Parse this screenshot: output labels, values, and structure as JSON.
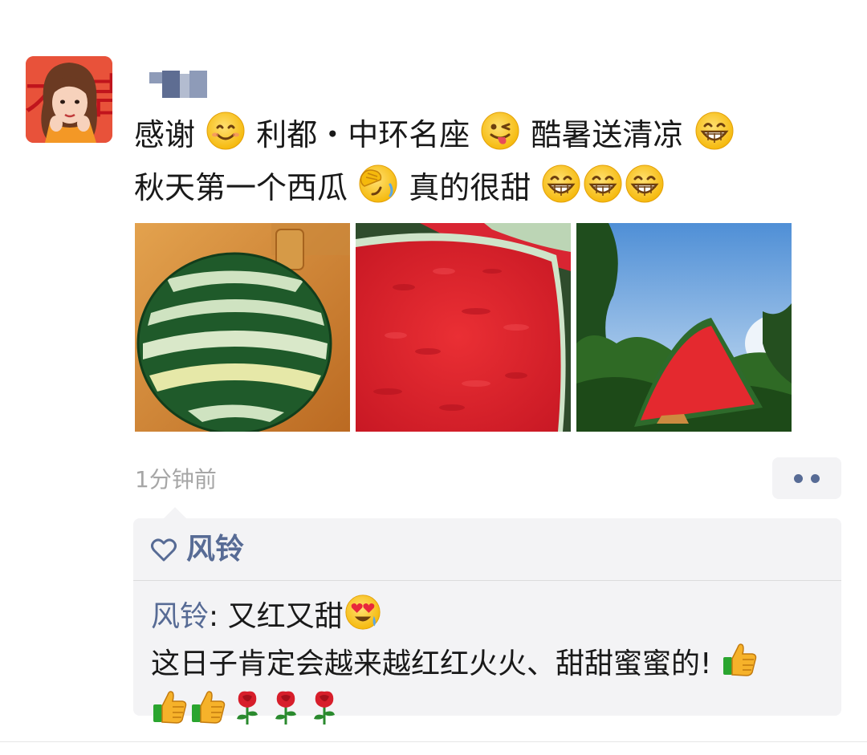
{
  "post": {
    "line1": [
      "感谢",
      " 利都・中环名座",
      "酷暑送清凉"
    ],
    "line2": [
      "秋天第一个西瓜",
      "真的很甜"
    ],
    "timestamp": "1分钟前"
  },
  "likes": {
    "names": "风铃"
  },
  "comment": {
    "author": "风铃",
    "separator": ": ",
    "line1_text": "又红又甜",
    "line2_text": "这日子肯定会越来越红红火火、甜甜蜜蜜的!"
  },
  "colors": {
    "link_blue": "#576b95",
    "panel_bg": "#f3f3f5",
    "timestamp_gray": "#a6a6a6",
    "avatar_bg": "#e8523a"
  },
  "icons": {
    "post_emojis": [
      "smile-emoji",
      "wink-tongue-emoji",
      "grin-emoji",
      "facepalm-emoji",
      "grin-emoji",
      "grin-emoji",
      "grin-emoji"
    ],
    "comment_emojis": [
      "heart-eyes-emoji",
      "thumbs-up-emoji",
      "thumbs-up-emoji",
      "thumbs-up-emoji",
      "rose-emoji",
      "rose-emoji",
      "rose-emoji"
    ],
    "likes": "heart-outline-icon",
    "more": "more-dots-icon"
  }
}
